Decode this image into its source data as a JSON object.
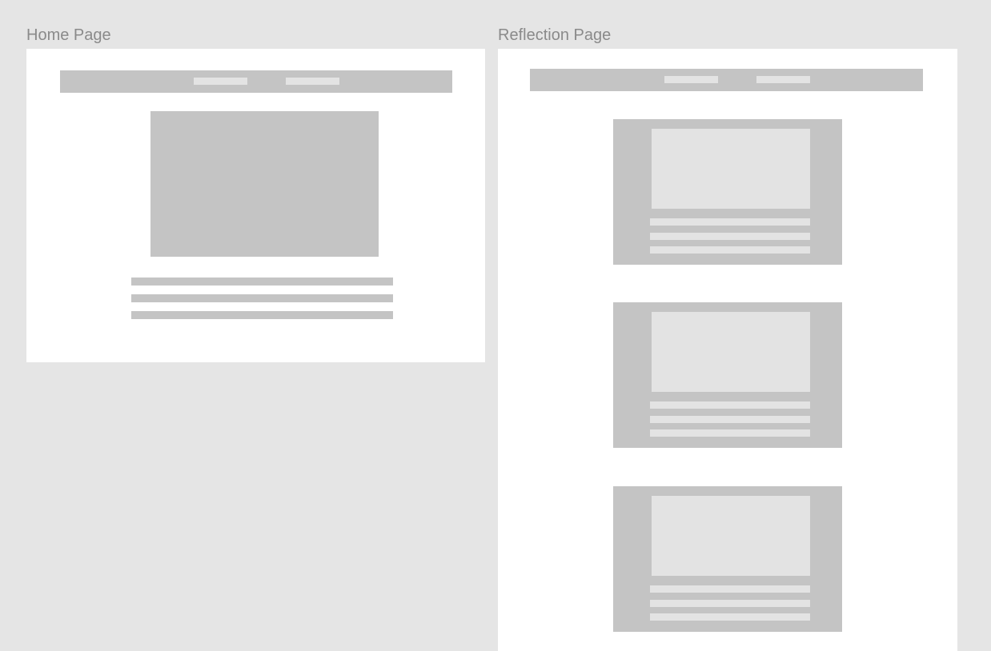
{
  "canvas": {
    "background_color": "#e5e5e5"
  },
  "frames": {
    "home": {
      "label": "Home Page"
    },
    "reflection": {
      "label": "Reflection Page",
      "cards": 3
    }
  },
  "colors": {
    "frame_background": "#ffffff",
    "placeholder_dark": "#c4c4c4",
    "placeholder_light": "#e3e3e3",
    "label_text": "#8a8a8a"
  }
}
